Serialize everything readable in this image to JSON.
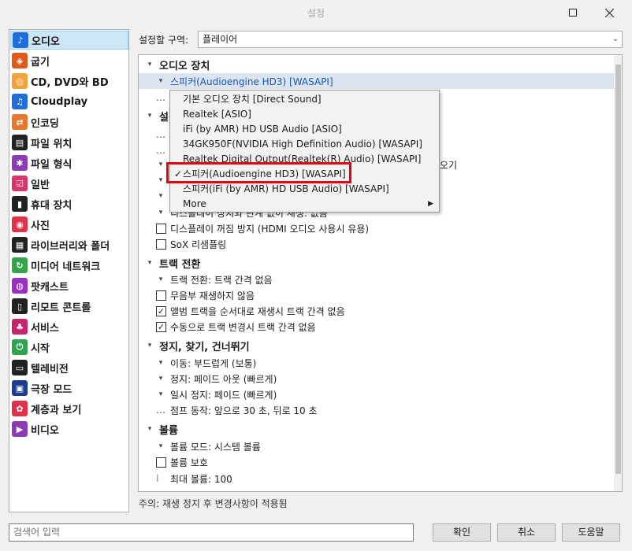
{
  "window": {
    "title": "설정"
  },
  "sidebar": {
    "items": [
      {
        "label": "오디오",
        "icon": "audio-note-icon",
        "color": "#1e6fd9"
      },
      {
        "label": "굽기",
        "icon": "burn-flame-icon",
        "color": "#e05a1c"
      },
      {
        "label": "CD, DVD와 BD",
        "icon": "disc-icon",
        "color": "#f2a33a"
      },
      {
        "label": "Cloudplay",
        "icon": "cloud-note-icon",
        "color": "#1e6fd9"
      },
      {
        "label": "인코딩",
        "icon": "encode-arrows-icon",
        "color": "#e8762c"
      },
      {
        "label": "파일 위치",
        "icon": "file-location-icon",
        "color": "#222222"
      },
      {
        "label": "파일 형식",
        "icon": "puzzle-icon",
        "color": "#8e3bb5"
      },
      {
        "label": "일반",
        "icon": "checkbox-icon",
        "color": "#d9356b"
      },
      {
        "label": "휴대 장치",
        "icon": "portable-device-icon",
        "color": "#222222"
      },
      {
        "label": "사진",
        "icon": "camera-icon",
        "color": "#e2324a"
      },
      {
        "label": "라이브러리와 폴더",
        "icon": "library-icon",
        "color": "#222222"
      },
      {
        "label": "미디어 네트워크",
        "icon": "network-icon",
        "color": "#33a54a"
      },
      {
        "label": "팟캐스트",
        "icon": "podcast-icon",
        "color": "#9b2fc2"
      },
      {
        "label": "리모트 콘트롤",
        "icon": "remote-icon",
        "color": "#222222"
      },
      {
        "label": "서비스",
        "icon": "service-icon",
        "color": "#c8246b"
      },
      {
        "label": "시작",
        "icon": "power-icon",
        "color": "#2ea44f"
      },
      {
        "label": "텔레비전",
        "icon": "tv-icon",
        "color": "#222222"
      },
      {
        "label": "극장 모드",
        "icon": "theater-icon",
        "color": "#1d3b8f"
      },
      {
        "label": "계층과 보기",
        "icon": "gear-icon",
        "color": "#e2324a"
      },
      {
        "label": "비디오",
        "icon": "video-icon",
        "color": "#8e3bb5"
      }
    ],
    "selected": 0
  },
  "region": {
    "label": "설정할 구역:",
    "value": "플레이어"
  },
  "tree": {
    "rows": [
      {
        "kind": "header",
        "arrow": "▾",
        "text": "오디오 장치"
      },
      {
        "kind": "dropdown",
        "arrow": "▾",
        "text": "스피커(Audioengine HD3) [WASAPI]",
        "highlight": true
      },
      {
        "kind": "dots",
        "text": ""
      },
      {
        "kind": "header",
        "arrow": "▾",
        "text": "설정"
      },
      {
        "kind": "dots",
        "text": ""
      },
      {
        "kind": "dots",
        "text": ""
      },
      {
        "kind": "dropdown",
        "arrow": "▾",
        "text": "오기"
      },
      {
        "kind": "dropdown",
        "arrow": "▾",
        "text": ""
      },
      {
        "kind": "dropdown",
        "arrow": "▾",
        "text": ""
      },
      {
        "kind": "dropdown",
        "arrow": "▾",
        "text": "디스플레이 장치와 관계 없이 재생: 없음"
      },
      {
        "kind": "check",
        "checked": false,
        "text": "디스플레이 꺼짐 방지 (HDMI 오디오 사용시 유용)"
      },
      {
        "kind": "check",
        "checked": false,
        "text": "SoX 리샘플링"
      },
      {
        "kind": "header",
        "arrow": "▾",
        "text": "트랙 전환"
      },
      {
        "kind": "dropdown",
        "arrow": "▾",
        "text": "트랙 전환: 트랙 간격 없음"
      },
      {
        "kind": "check",
        "checked": false,
        "text": "무음부 재생하지 않음"
      },
      {
        "kind": "check",
        "checked": true,
        "text": "앨범 트랙을 순서대로 재생시 트랙 간격 없음"
      },
      {
        "kind": "check",
        "checked": true,
        "text": "수동으로 트랙 변경시 트랙 간격 없음"
      },
      {
        "kind": "header",
        "arrow": "▾",
        "text": "정지, 찾기, 건너뛰기"
      },
      {
        "kind": "dropdown",
        "arrow": "▾",
        "text": "이동: 부드럽게 (보통)"
      },
      {
        "kind": "dropdown",
        "arrow": "▾",
        "text": "정지: 페이드 아웃 (빠르게)"
      },
      {
        "kind": "dropdown",
        "arrow": "▾",
        "text": "일시 정지: 페이드 (빠르게)"
      },
      {
        "kind": "dots",
        "text": "점프 동작: 앞으로 30 초, 뒤로 10 초"
      },
      {
        "kind": "header",
        "arrow": "▾",
        "text": "볼륨"
      },
      {
        "kind": "dropdown",
        "arrow": "▾",
        "text": "볼륨 모드: 시스템 볼륨"
      },
      {
        "kind": "check",
        "checked": false,
        "text": "볼륨 보호"
      },
      {
        "kind": "cursor",
        "text": "최대 볼륨: 100"
      }
    ]
  },
  "popup": {
    "items": [
      {
        "text": "기본 오디오 장치 [Direct Sound]",
        "checked": false
      },
      {
        "text": "Realtek [ASIO]",
        "checked": false
      },
      {
        "text": "iFi (by AMR) HD USB Audio [ASIO]",
        "checked": false
      },
      {
        "text": "34GK950F(NVIDIA High Definition Audio) [WASAPI]",
        "checked": false
      },
      {
        "text": "Realtek Digital Output(Realtek(R) Audio) [WASAPI]",
        "checked": false
      },
      {
        "text": "스피커(Audioengine HD3) [WASAPI]",
        "checked": true
      },
      {
        "text": "스피커(iFi (by AMR) HD USB Audio) [WASAPI]",
        "checked": false
      },
      {
        "text": "More",
        "checked": false,
        "submenu": true
      }
    ],
    "check_mark": "✓",
    "submenu_arrow": "▶",
    "highlight_color": "#e3000f"
  },
  "note": "주의: 재생 정지 후 변경사항이 적용됨",
  "search": {
    "placeholder": "검색어 입력"
  },
  "buttons": {
    "ok": "확인",
    "cancel": "취소",
    "help": "도움말"
  }
}
